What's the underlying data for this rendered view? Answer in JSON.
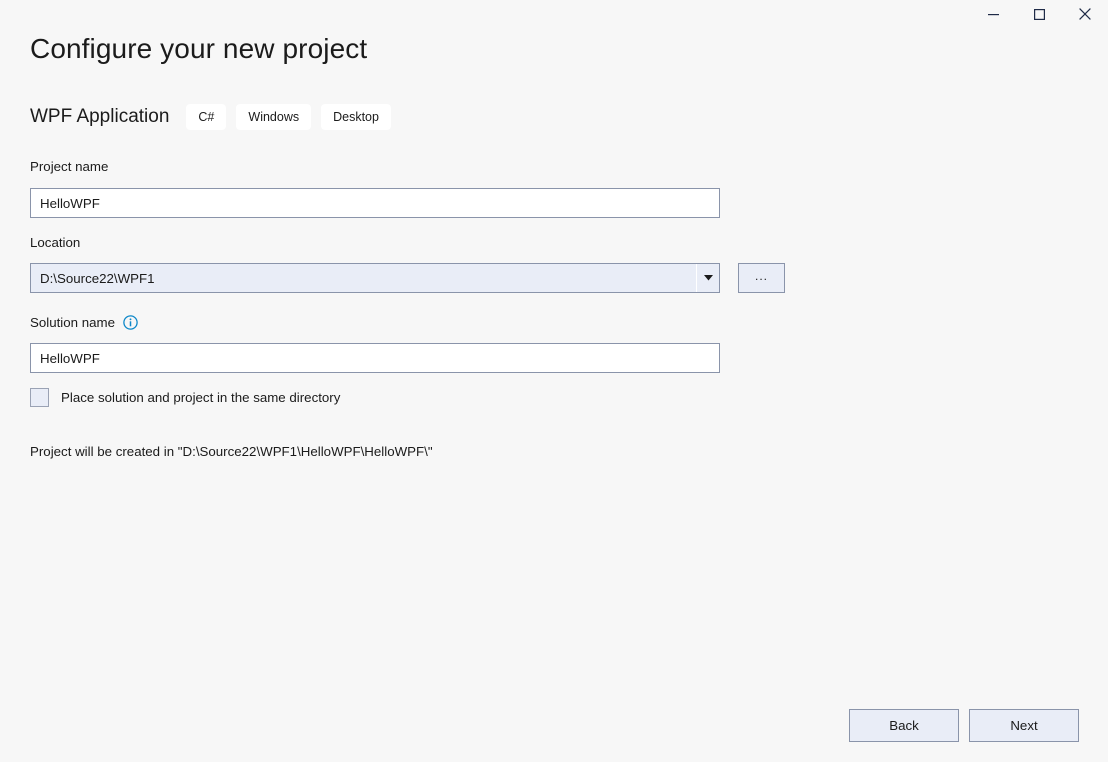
{
  "window": {
    "controls": [
      {
        "name": "minimize",
        "glyph": "minimize-icon"
      },
      {
        "name": "maximize",
        "glyph": "maximize-icon"
      },
      {
        "name": "close",
        "glyph": "close-icon"
      }
    ]
  },
  "header": {
    "title": "Configure your new project",
    "template_name": "WPF Application",
    "tags": [
      "C#",
      "Windows",
      "Desktop"
    ]
  },
  "form": {
    "project_name": {
      "label": "Project name",
      "value": "HelloWPF",
      "placeholder": ""
    },
    "location": {
      "label": "Location",
      "value": "D:\\Source22\\WPF1",
      "browse_label": "...",
      "dropdown_icon": "chevron-down-icon"
    },
    "solution_name": {
      "label": "Solution name",
      "value": "HelloWPF",
      "placeholder": "",
      "info_icon": "info-icon"
    },
    "same_directory": {
      "label": "Place solution and project in the same directory",
      "checked": false
    },
    "created_note": "Project will be created in \"D:\\Source22\\WPF1\\HelloWPF\\HelloWPF\\\""
  },
  "footer": {
    "back_label": "Back",
    "next_label": "Next"
  },
  "colors": {
    "page_background": "#F7F7F7",
    "field_border": "#8A94AA",
    "field_background": "#FFFFFF",
    "control_fill": "#E9EDF7",
    "info_blue": "#0078D4",
    "text": "#1B1B1B"
  }
}
